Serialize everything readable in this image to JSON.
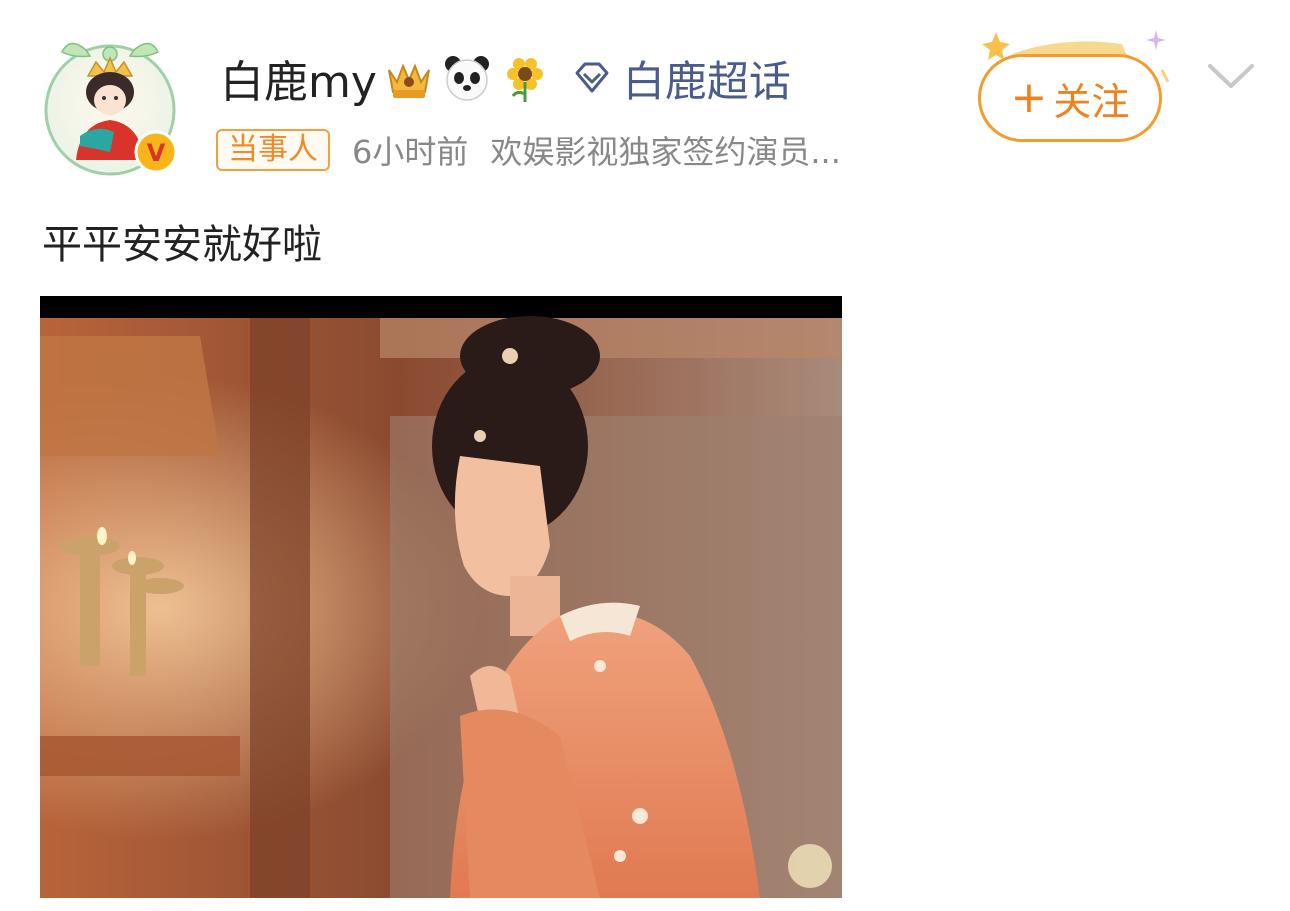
{
  "post": {
    "author": {
      "name": "白鹿my",
      "badges": [
        "crown-badge-icon",
        "panda-icon",
        "sunflower-icon"
      ],
      "verified": true
    },
    "supertopic": {
      "icon": "diamond-icon",
      "label": "白鹿超话"
    },
    "meta": {
      "tag": "当事人",
      "time": "6小时前",
      "description": "欢娱影视独家签约演员..."
    },
    "follow": {
      "plus": "+",
      "label": "关注"
    },
    "menu_icon": "chevron-down-icon",
    "text": "平平安安就好啦",
    "image": {
      "icon": "photo",
      "subject": "woman-in-orange-hanfu-praying"
    }
  },
  "colors": {
    "accent_orange": "#f59a2c",
    "topic_blue": "#4a5b8c",
    "meta_gray": "#888888"
  }
}
